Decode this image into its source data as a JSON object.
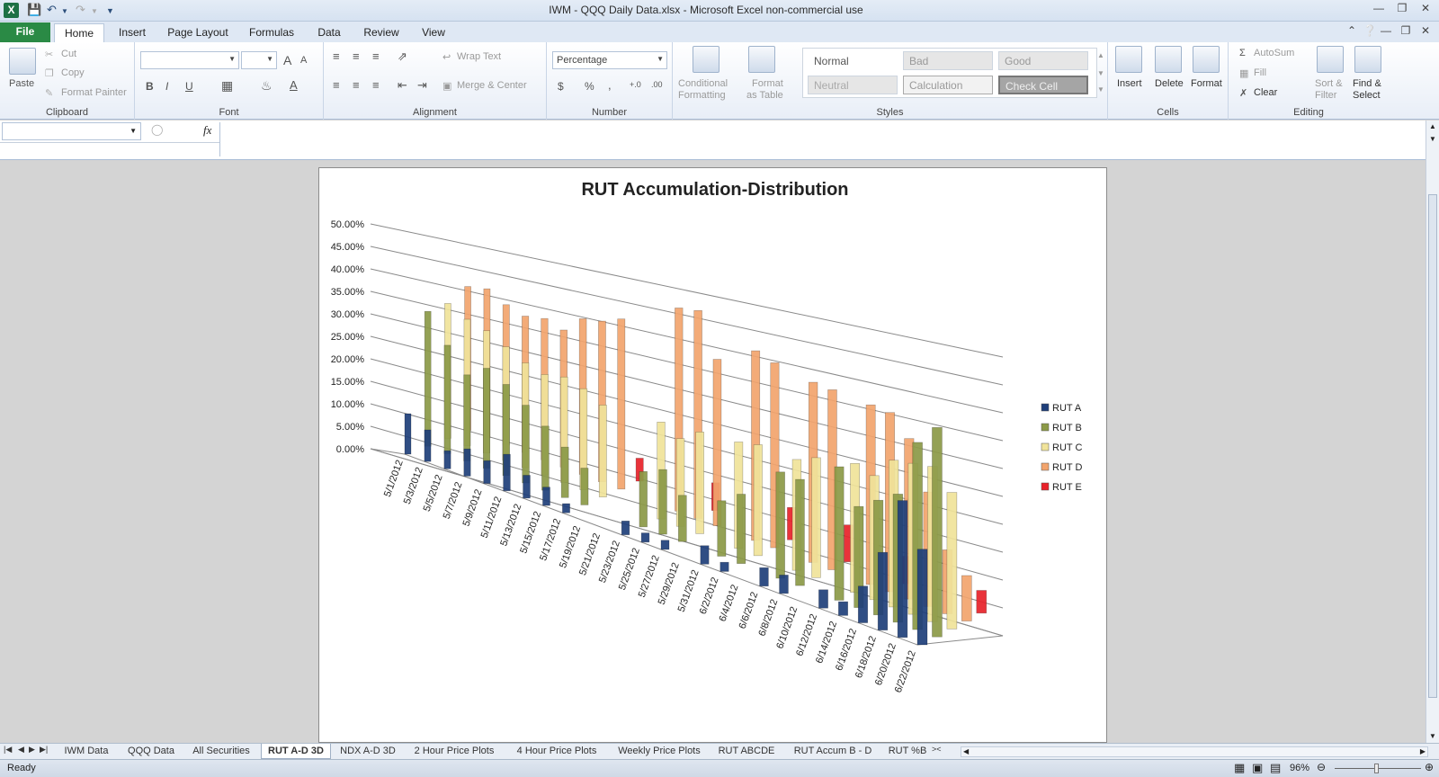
{
  "window": {
    "title": "IWM - QQQ  Daily Data.xlsx  -  Microsoft Excel non-commercial use",
    "app_icon": "X"
  },
  "ribbon_tabs": [
    "File",
    "Home",
    "Insert",
    "Page Layout",
    "Formulas",
    "Data",
    "Review",
    "View"
  ],
  "clipboard": {
    "paste": "Paste",
    "cut": "Cut",
    "copy": "Copy",
    "format_painter": "Format Painter",
    "label": "Clipboard"
  },
  "font": {
    "label": "Font",
    "bold": "B",
    "italic": "I",
    "underline": "U",
    "grow": "A",
    "shrink": "A",
    "color": "A"
  },
  "alignment": {
    "label": "Alignment",
    "wrap_text": "Wrap Text",
    "merge_center": "Merge & Center"
  },
  "number": {
    "label": "Number",
    "format": "Percentage",
    "currency": "$",
    "percent": "%",
    "comma": ",",
    "inc": "+.0",
    "dec": ".00"
  },
  "styles": {
    "label": "Styles",
    "conditional": "Conditional",
    "conditional2": "Formatting",
    "format_table": "Format",
    "format_table2": "as Table",
    "normal": "Normal",
    "bad": "Bad",
    "good": "Good",
    "neutral": "Neutral",
    "calculation": "Calculation",
    "check_cell": "Check Cell"
  },
  "cells": {
    "label": "Cells",
    "insert": "Insert",
    "delete": "Delete",
    "format": "Format"
  },
  "editing": {
    "label": "Editing",
    "autosum": "AutoSum",
    "fill": "Fill",
    "clear": "Clear",
    "sort": "Sort &",
    "sort2": "Filter",
    "find": "Find &",
    "find2": "Select"
  },
  "formula_bar": {
    "fx": "fx",
    "name_value": "",
    "formula": ""
  },
  "colors": {
    "rut_a": "#1f3f7a",
    "rut_b": "#8c9a47",
    "rut_c": "#f0e39a",
    "rut_d": "#f2a46d",
    "rut_e": "#e8222a"
  },
  "chart_data": {
    "type": "bar",
    "title": "RUT Accumulation-Distribution",
    "xlabel": "",
    "ylabel": "",
    "ylim": [
      0,
      0.5
    ],
    "ytick_labels": [
      "0.00%",
      "5.00%",
      "10.00%",
      "15.00%",
      "20.00%",
      "25.00%",
      "30.00%",
      "35.00%",
      "40.00%",
      "45.00%",
      "50.00%"
    ],
    "categories": [
      "5/1/2012",
      "5/3/2012",
      "5/5/2012",
      "5/7/2012",
      "5/9/2012",
      "5/11/2012",
      "5/13/2012",
      "5/15/2012",
      "5/17/2012",
      "5/19/2012",
      "5/21/2012",
      "5/23/2012",
      "5/25/2012",
      "5/27/2012",
      "5/29/2012",
      "5/31/2012",
      "6/2/2012",
      "6/4/2012",
      "6/6/2012",
      "6/8/2012",
      "6/10/2012",
      "6/12/2012",
      "6/14/2012",
      "6/16/2012",
      "6/18/2012",
      "6/20/2012",
      "6/22/2012"
    ],
    "series": [
      {
        "name": "RUT A",
        "values": [
          0.09,
          0.07,
          0.04,
          0.06,
          0.05,
          0.08,
          0.05,
          0.04,
          0.02,
          0,
          0,
          0.03,
          0.02,
          0.02,
          0,
          0.04,
          0.02,
          0,
          0.04,
          0.04,
          0,
          0.04,
          0.03,
          0.08,
          0.17,
          0.3,
          0.21
        ]
      },
      {
        "name": "RUT B",
        "values": [
          0.3,
          0.24,
          0.19,
          0.22,
          0.2,
          0.17,
          0.14,
          0.11,
          0.08,
          0,
          0,
          0.12,
          0.14,
          0.1,
          0,
          0.12,
          0.15,
          0,
          0.23,
          0.23,
          0,
          0.29,
          0.22,
          0.25,
          0.28,
          0.41,
          0.46
        ]
      },
      {
        "name": "RUT C",
        "values": [
          0.3,
          0.28,
          0.27,
          0.25,
          0.23,
          0.22,
          0.23,
          0.22,
          0.2,
          0,
          0,
          0.21,
          0.19,
          0.22,
          0,
          0.23,
          0.24,
          0,
          0.24,
          0.26,
          0,
          0.28,
          0.27,
          0.32,
          0.33,
          0.34,
          0.3
        ]
      },
      {
        "name": "RUT D",
        "values": [
          0.32,
          0.33,
          0.31,
          0.3,
          0.31,
          0.3,
          0.34,
          0.35,
          0.37,
          0,
          0,
          0.44,
          0.45,
          0.36,
          0,
          0.41,
          0.4,
          0,
          0.39,
          0.39,
          0,
          0.39,
          0.39,
          0.35,
          0.25,
          0.14,
          0.1
        ]
      },
      {
        "name": "RUT E",
        "values": [
          0,
          0,
          0,
          0,
          0,
          0,
          0,
          0,
          0.05,
          0,
          0,
          0,
          0.06,
          0,
          0,
          0,
          0.07,
          0,
          0,
          0.08,
          0,
          0,
          0.06,
          0,
          0,
          0,
          0.05
        ]
      }
    ],
    "legend_position": "right",
    "grid": true
  },
  "sheet_tabs": [
    "IWM Data",
    "QQQ Data",
    "All Securities",
    "RUT A-D 3D",
    "NDX A-D 3D",
    "2 Hour Price Plots",
    "4 Hour Price Plots",
    "Weekly Price Plots",
    "RUT ABCDE",
    "RUT Accum B - D",
    "RUT %B"
  ],
  "active_sheet": "RUT A-D 3D",
  "statusbar": {
    "ready": "Ready",
    "zoom": "96%"
  }
}
